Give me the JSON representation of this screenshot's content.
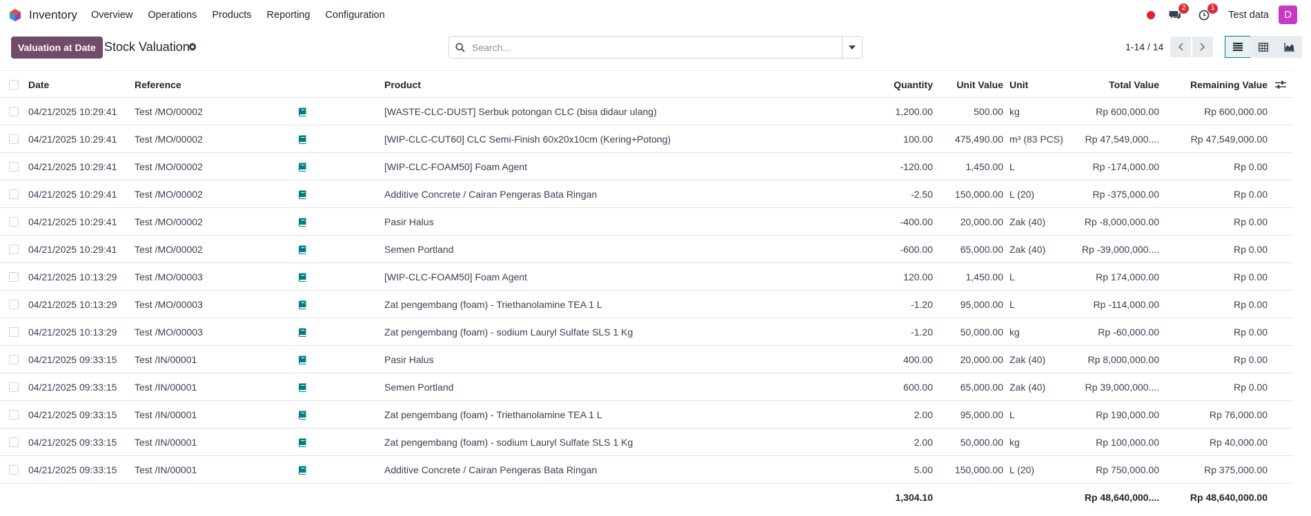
{
  "app": {
    "name": "Inventory"
  },
  "menu": [
    {
      "label": "Overview"
    },
    {
      "label": "Operations"
    },
    {
      "label": "Products"
    },
    {
      "label": "Reporting"
    },
    {
      "label": "Configuration"
    }
  ],
  "systray": {
    "messages_count": "2",
    "activities_count": "1",
    "company": "Test data",
    "avatar_initial": "D"
  },
  "controls": {
    "primary_button": "Valuation at Date",
    "title": "Stock Valuation",
    "search_placeholder": "Search...",
    "pager": "1-14 / 14"
  },
  "table": {
    "columns": {
      "date": "Date",
      "reference": "Reference",
      "product": "Product",
      "quantity": "Quantity",
      "unit_value": "Unit Value",
      "unit": "Unit",
      "total_value": "Total Value",
      "remaining_value": "Remaining Value"
    },
    "rows": [
      {
        "date": "04/21/2025 10:29:41",
        "reference": "Test /MO/00002",
        "product": "[WASTE-CLC-DUST] Serbuk potongan CLC (bisa didaur ulang)",
        "quantity": "1,200.00",
        "unit_value": "500.00",
        "unit": "kg",
        "total_value": "Rp 600,000.00",
        "remaining_value": "Rp 600,000.00"
      },
      {
        "date": "04/21/2025 10:29:41",
        "reference": "Test /MO/00002",
        "product": "[WIP-CLC-CUT60] CLC Semi-Finish 60x20x10cm (Kering+Potong)",
        "quantity": "100.00",
        "unit_value": "475,490.00",
        "unit": "m³ (83 PCS)",
        "total_value": "Rp 47,549,000....",
        "remaining_value": "Rp 47,549,000.00"
      },
      {
        "date": "04/21/2025 10:29:41",
        "reference": "Test /MO/00002",
        "product": "[WIP-CLC-FOAM50] Foam Agent",
        "quantity": "-120.00",
        "unit_value": "1,450.00",
        "unit": "L",
        "total_value": "Rp -174,000.00",
        "remaining_value": "Rp 0.00"
      },
      {
        "date": "04/21/2025 10:29:41",
        "reference": "Test /MO/00002",
        "product": "Additive Concrete / Cairan Pengeras Bata Ringan",
        "quantity": "-2.50",
        "unit_value": "150,000.00",
        "unit": "L (20)",
        "total_value": "Rp -375,000.00",
        "remaining_value": "Rp 0.00"
      },
      {
        "date": "04/21/2025 10:29:41",
        "reference": "Test /MO/00002",
        "product": "Pasir Halus",
        "quantity": "-400.00",
        "unit_value": "20,000.00",
        "unit": "Zak (40)",
        "total_value": "Rp -8,000,000.00",
        "remaining_value": "Rp 0.00"
      },
      {
        "date": "04/21/2025 10:29:41",
        "reference": "Test /MO/00002",
        "product": "Semen Portland",
        "quantity": "-600.00",
        "unit_value": "65,000.00",
        "unit": "Zak (40)",
        "total_value": "Rp -39,000,000....",
        "remaining_value": "Rp 0.00"
      },
      {
        "date": "04/21/2025 10:13:29",
        "reference": "Test /MO/00003",
        "product": "[WIP-CLC-FOAM50] Foam Agent",
        "quantity": "120.00",
        "unit_value": "1,450.00",
        "unit": "L",
        "total_value": "Rp 174,000.00",
        "remaining_value": "Rp 0.00"
      },
      {
        "date": "04/21/2025 10:13:29",
        "reference": "Test /MO/00003",
        "product": "Zat pengembang (foam) - Triethanolamine TEA 1 L",
        "quantity": "-1.20",
        "unit_value": "95,000.00",
        "unit": "L",
        "total_value": "Rp -114,000.00",
        "remaining_value": "Rp 0.00"
      },
      {
        "date": "04/21/2025 10:13:29",
        "reference": "Test /MO/00003",
        "product": "Zat pengembang (foam) - sodium Lauryl Sulfate SLS 1 Kg",
        "quantity": "-1.20",
        "unit_value": "50,000.00",
        "unit": "kg",
        "total_value": "Rp -60,000.00",
        "remaining_value": "Rp 0.00"
      },
      {
        "date": "04/21/2025 09:33:15",
        "reference": "Test /IN/00001",
        "product": "Pasir Halus",
        "quantity": "400.00",
        "unit_value": "20,000.00",
        "unit": "Zak (40)",
        "total_value": "Rp 8,000,000.00",
        "remaining_value": "Rp 0.00"
      },
      {
        "date": "04/21/2025 09:33:15",
        "reference": "Test /IN/00001",
        "product": "Semen Portland",
        "quantity": "600.00",
        "unit_value": "65,000.00",
        "unit": "Zak (40)",
        "total_value": "Rp 39,000,000....",
        "remaining_value": "Rp 0.00"
      },
      {
        "date": "04/21/2025 09:33:15",
        "reference": "Test /IN/00001",
        "product": "Zat pengembang (foam) - Triethanolamine TEA 1 L",
        "quantity": "2.00",
        "unit_value": "95,000.00",
        "unit": "L",
        "total_value": "Rp 190,000.00",
        "remaining_value": "Rp 76,000.00"
      },
      {
        "date": "04/21/2025 09:33:15",
        "reference": "Test /IN/00001",
        "product": "Zat pengembang (foam) - sodium Lauryl Sulfate SLS 1 Kg",
        "quantity": "2.00",
        "unit_value": "50,000.00",
        "unit": "kg",
        "total_value": "Rp 100,000.00",
        "remaining_value": "Rp 40,000.00"
      },
      {
        "date": "04/21/2025 09:33:15",
        "reference": "Test /IN/00001",
        "product": "Additive Concrete / Cairan Pengeras Bata Ringan",
        "quantity": "5.00",
        "unit_value": "150,000.00",
        "unit": "L (20)",
        "total_value": "Rp 750,000.00",
        "remaining_value": "Rp 375,000.00"
      }
    ],
    "totals": {
      "quantity": "1,304.10",
      "total_value": "Rp 48,640,000....",
      "remaining_value": "Rp 48,640,000.00"
    }
  },
  "colors": {
    "primary": "#714b67",
    "accent": "#017e84",
    "badge": "#d9313a",
    "avatar": "#c838c4"
  },
  "icons": [
    "odoo-logo-icon",
    "record-dot-icon",
    "chat-icon",
    "clock-icon",
    "gear-icon",
    "search-icon",
    "chevron-down-icon",
    "chevron-left-icon",
    "chevron-right-icon",
    "list-view-icon",
    "pivot-view-icon",
    "graph-view-icon",
    "book-icon",
    "adjust-columns-icon"
  ]
}
